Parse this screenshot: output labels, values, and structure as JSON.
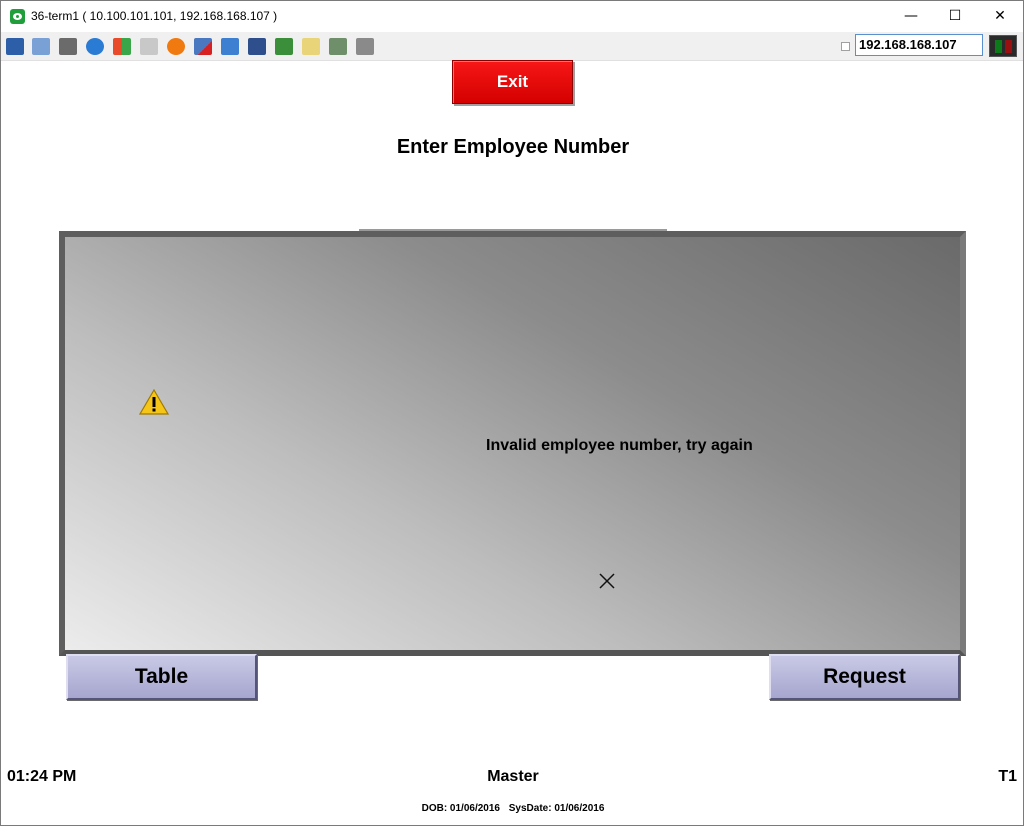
{
  "window": {
    "title": "36-term1 ( 10.100.101.101, 192.168.168.107 )",
    "minimize_glyph": "—",
    "maximize_glyph": "☐",
    "close_glyph": "✕"
  },
  "toolbar": {
    "icons": [
      "monitor-activity-icon",
      "windows-icon",
      "tools-icon",
      "refresh-icon",
      "windows-flag-icon",
      "keyboard-icon",
      "alert-icon",
      "disconnect-icon",
      "fullscreen-icon",
      "display-icon",
      "download-icon",
      "note-icon",
      "map-icon",
      "chat-icon"
    ],
    "ip_address": "192.168.168.107",
    "status_colors": [
      "#0d7a1a",
      "#9a0f0f"
    ]
  },
  "main": {
    "exit_label": "Exit",
    "heading": "Enter Employee Number"
  },
  "dialog": {
    "message": "Invalid employee number, try again",
    "icon": "warning-icon"
  },
  "buttons": {
    "table_label": "Table",
    "request_label": "Request"
  },
  "footer": {
    "time": "01:24 PM",
    "mode": "Master",
    "terminal": "T1",
    "dob": "DOB: 01/06/2016",
    "sysdate": "SysDate: 01/06/2016"
  },
  "colors": {
    "exit_red": "#e60000",
    "button_lavender": "#b8b8dc",
    "accent_blue": "#5a8fd0"
  }
}
